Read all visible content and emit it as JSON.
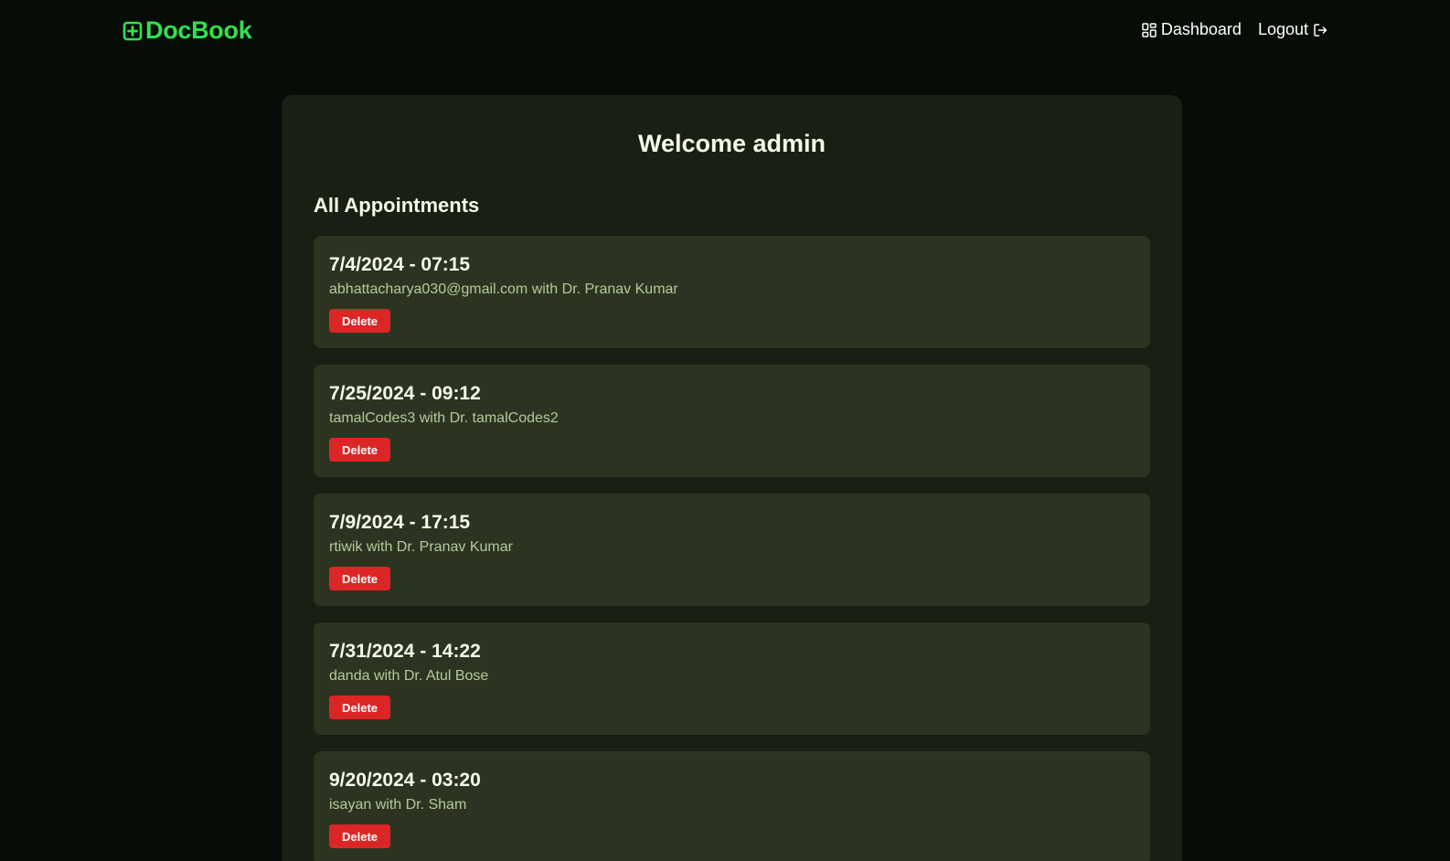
{
  "brand": {
    "name": "DocBook",
    "icon": "plus-square-icon",
    "color": "#33e04d"
  },
  "nav": {
    "dashboard_label": "Dashboard",
    "dashboard_icon": "grid-icon",
    "logout_label": "Logout",
    "logout_icon": "logout-icon"
  },
  "main": {
    "welcome": "Welcome admin",
    "section_title": "All Appointments",
    "delete_label": "Delete",
    "appointments": [
      {
        "datetime": "7/4/2024 - 07:15",
        "details": "abhattacharya030@gmail.com with Dr. Pranav Kumar"
      },
      {
        "datetime": "7/25/2024 - 09:12",
        "details": "tamalCodes3 with Dr. tamalCodes2"
      },
      {
        "datetime": "7/9/2024 - 17:15",
        "details": "rtiwik with Dr. Pranav Kumar"
      },
      {
        "datetime": "7/31/2024 - 14:22",
        "details": "danda with Dr. Atul Bose"
      },
      {
        "datetime": "9/20/2024 - 03:20",
        "details": "isayan with Dr. Sham"
      }
    ]
  },
  "colors": {
    "background": "#070d06",
    "panel": "#1a1f13",
    "card": "#2c3421",
    "danger": "#dc2626"
  }
}
